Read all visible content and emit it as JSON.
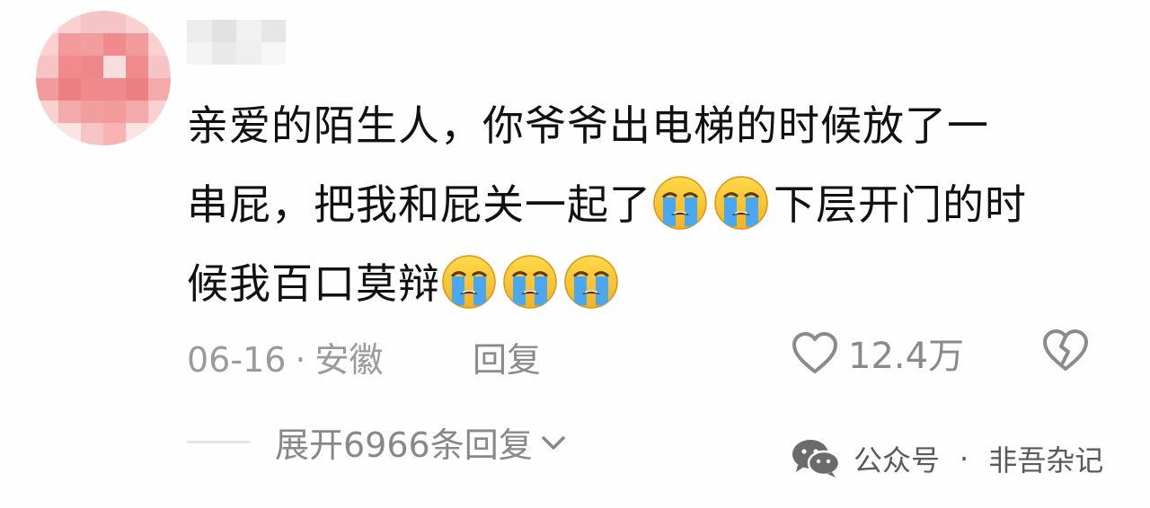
{
  "comment": {
    "line1": "亲爱的陌生人，你爷爷出电梯的时候放了一",
    "line2_before": "串屁，把我和屁关一起了",
    "line2_after": "下层开门的时",
    "line3": "候我百口莫辩",
    "emoji": "loudly-crying-face"
  },
  "meta": {
    "date": "06-16",
    "dot": "·",
    "location": "安徽",
    "reply_label": "回复",
    "like_count": "12.4万"
  },
  "expand": {
    "label": "展开6966条回复"
  },
  "watermark": {
    "account_type": "公众号",
    "dot": "·",
    "name": "非吾杂记"
  },
  "colors": {
    "text": "#111111",
    "meta": "#9a9a9a",
    "avatar_primary": "#f08a8c"
  },
  "icons": [
    "heart-icon",
    "broken-heart-icon",
    "chevron-down-icon",
    "wechat-logo-icon",
    "loudly-crying-face-emoji"
  ]
}
